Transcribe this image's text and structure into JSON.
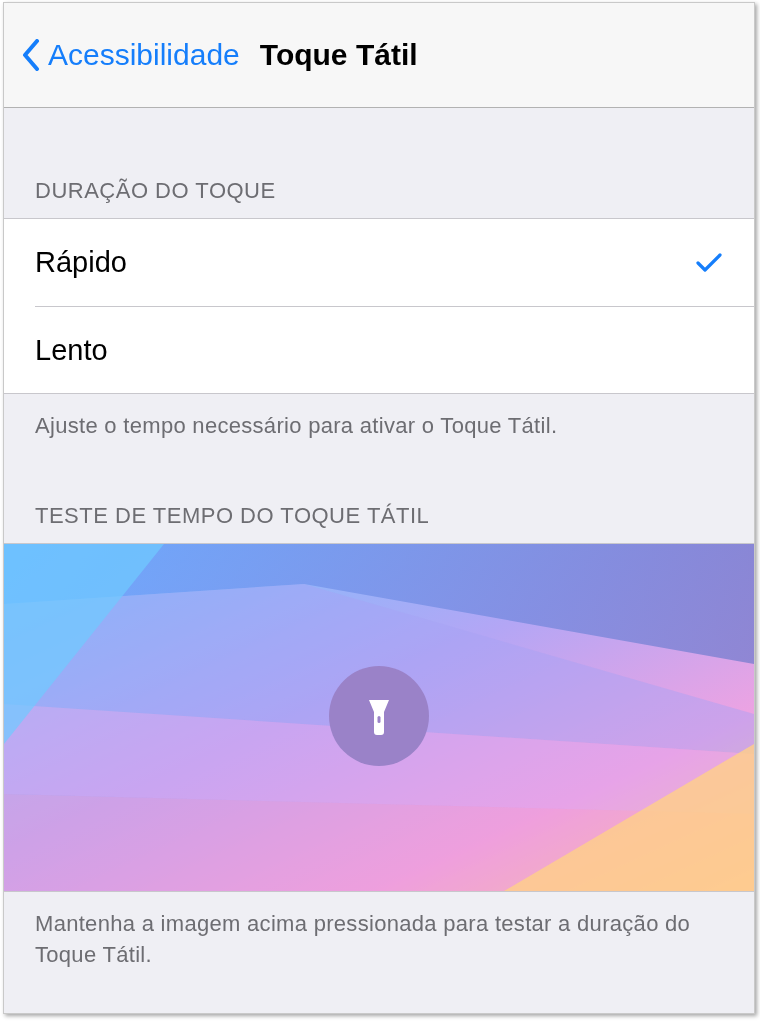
{
  "nav": {
    "back_label": "Acessibilidade",
    "title": "Toque Tátil"
  },
  "sections": [
    {
      "kind": "options",
      "header": "DURAÇÃO DO TOQUE",
      "options": [
        {
          "label": "Rápido",
          "selected": true
        },
        {
          "label": "Lento",
          "selected": false
        }
      ],
      "footer": "Ajuste o tempo necessário para ativar o Toque Tátil."
    },
    {
      "kind": "test_image",
      "header": "TESTE DE TEMPO DO TOQUE TÁTIL",
      "footer": "Mantenha a imagem acima pressionada para testar a duração do Toque Tátil."
    }
  ]
}
